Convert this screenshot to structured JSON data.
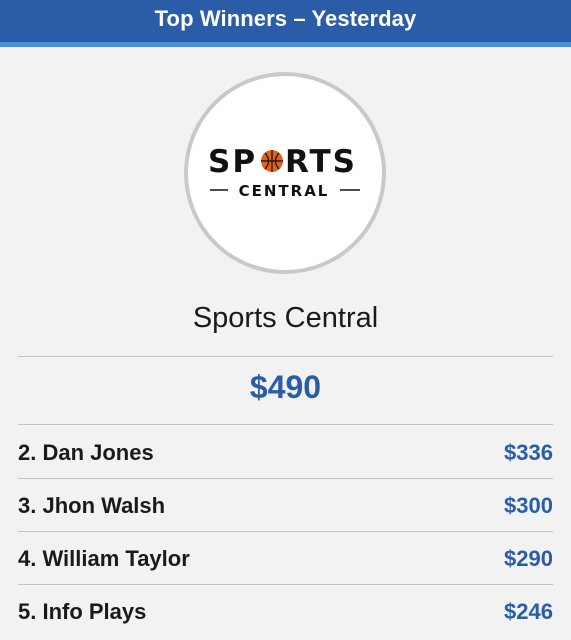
{
  "header": {
    "title": "Top Winners – Yesterday"
  },
  "winner": {
    "logo": {
      "word_top": "SPORTS",
      "word_bottom": "CENTRAL",
      "ball_color": "#e0611f"
    },
    "name": "Sports Central",
    "amount": "$490"
  },
  "runners_up": [
    {
      "name": "2. Dan Jones",
      "amount": "$336"
    },
    {
      "name": "3. Jhon Walsh",
      "amount": "$300"
    },
    {
      "name": "4. William Taylor",
      "amount": "$290"
    },
    {
      "name": "5. Info Plays",
      "amount": "$246"
    }
  ],
  "colors": {
    "header_bg": "#2a5ca8",
    "header_accent": "#4a90d9",
    "amount": "#2a5ca8",
    "background": "#f2f2f2"
  }
}
